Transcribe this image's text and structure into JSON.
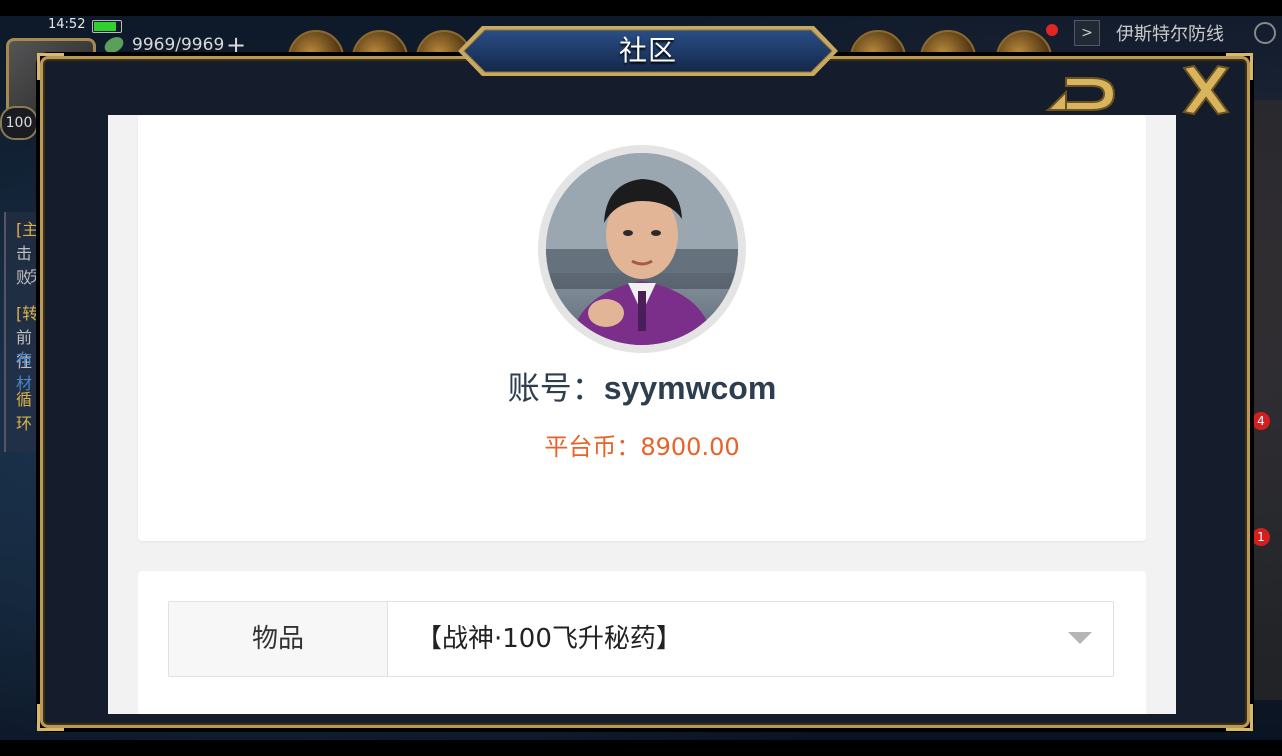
{
  "status_bar": {
    "time": "14:52"
  },
  "hud": {
    "stamina": "9969/9969",
    "stamina_plus": "+",
    "level": "100",
    "quest_title": "伊斯特尔防线",
    "left_quests": [
      "[主]",
      "击败",
      "完",
      "[转]",
      "前往",
      "布材",
      "循环"
    ],
    "badges": [
      "4",
      "1"
    ]
  },
  "dialog": {
    "title": "社区",
    "back_icon": "back-arrow-icon",
    "close_icon": "close-x-icon"
  },
  "profile": {
    "account_label": "账号：",
    "account_value": "syymwcom",
    "coin_label": "平台币：",
    "coin_value": "8900.00"
  },
  "form": {
    "item_label": "物品",
    "item_selected": "【战神·100飞升秘药】"
  },
  "colors": {
    "frame_gold": "#b99a57",
    "dialog_bg": "#151c2b",
    "title_plate": "#1e3a66",
    "account_text": "#2d3e50",
    "coin_text": "#e8622a"
  }
}
